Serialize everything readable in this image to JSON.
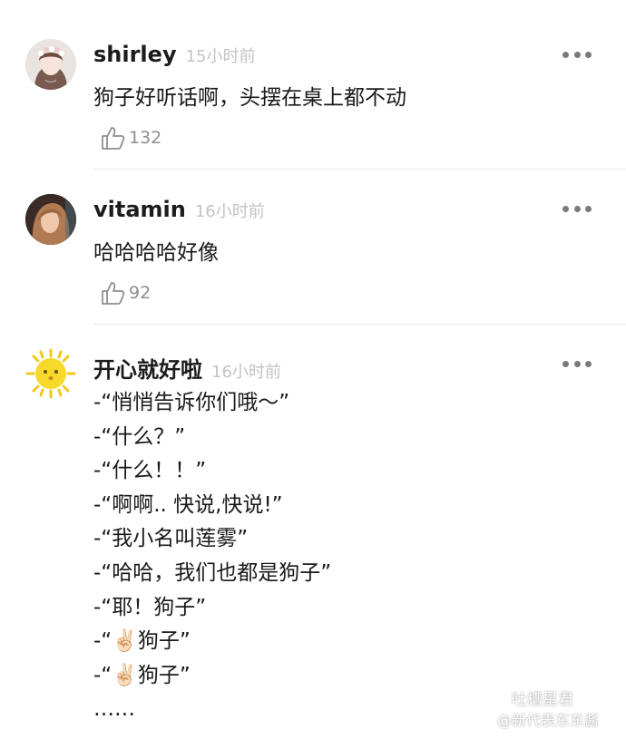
{
  "comments": [
    {
      "user": "shirley",
      "time": "15小时前",
      "text": "狗子好听话啊，头摆在桌上都不动",
      "likes": "132",
      "avatar_icon": "girl-with-flower-crown-avatar",
      "more_icon": "more-dots-icon"
    },
    {
      "user": "vitamin",
      "time": "16小时前",
      "text": "哈哈哈哈好像",
      "likes": "92",
      "avatar_icon": "girl-portrait-avatar",
      "more_icon": "more-dots-icon"
    },
    {
      "user": "开心就好啦",
      "time": "16小时前",
      "lines": [
        "-“悄悄告诉你们哦～”",
        "-“什么？”",
        "-“什么！！”",
        "-“啊啊.. 快说,快说!”",
        "-“我小名叫莲雾”",
        "-“哈哈，我们也都是狗子”",
        "-“耶！狗子”",
        "-“✌🏻狗子”",
        "-“✌🏻狗子”",
        "……"
      ],
      "avatar_icon": "sun-emoji-avatar",
      "more_icon": "more-dots-icon"
    }
  ],
  "watermark": {
    "line1": "吐槽星君",
    "line2": "@新代表东东酱",
    "icon": "weibo-logo-icon"
  },
  "colors": {
    "time": "#c3c3c3",
    "like": "#8f8f8f",
    "divider": "#e8e8e8",
    "sun": "#f7d92a"
  }
}
